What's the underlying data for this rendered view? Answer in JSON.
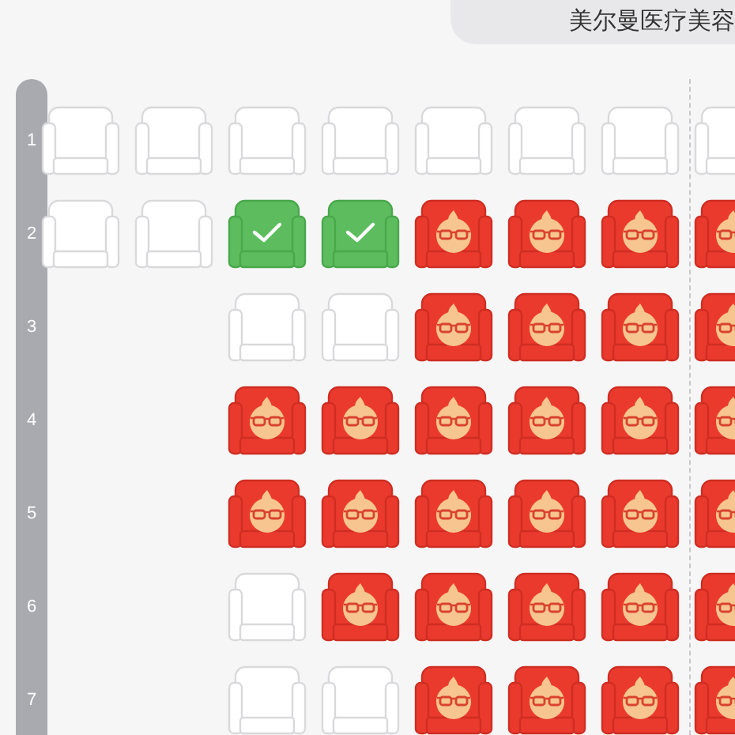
{
  "header": {
    "title": "美尔曼医疗美容"
  },
  "rows": [
    {
      "label": "1",
      "seats": [
        {
          "kind": "empty"
        },
        {
          "kind": "empty"
        },
        {
          "kind": "empty"
        },
        {
          "kind": "empty"
        },
        {
          "kind": "empty"
        },
        {
          "kind": "empty"
        },
        {
          "kind": "empty"
        },
        {
          "kind": "empty"
        }
      ]
    },
    {
      "label": "2",
      "seats": [
        {
          "kind": "empty"
        },
        {
          "kind": "empty"
        },
        {
          "kind": "selected"
        },
        {
          "kind": "selected"
        },
        {
          "kind": "sold"
        },
        {
          "kind": "sold"
        },
        {
          "kind": "sold"
        },
        {
          "kind": "sold"
        }
      ]
    },
    {
      "label": "3",
      "seats": [
        {
          "kind": "gap"
        },
        {
          "kind": "gap"
        },
        {
          "kind": "empty"
        },
        {
          "kind": "empty"
        },
        {
          "kind": "sold"
        },
        {
          "kind": "sold"
        },
        {
          "kind": "sold"
        },
        {
          "kind": "sold"
        }
      ]
    },
    {
      "label": "4",
      "seats": [
        {
          "kind": "gap"
        },
        {
          "kind": "gap"
        },
        {
          "kind": "sold"
        },
        {
          "kind": "sold"
        },
        {
          "kind": "sold"
        },
        {
          "kind": "sold"
        },
        {
          "kind": "sold"
        },
        {
          "kind": "sold"
        }
      ]
    },
    {
      "label": "5",
      "seats": [
        {
          "kind": "gap"
        },
        {
          "kind": "gap"
        },
        {
          "kind": "sold"
        },
        {
          "kind": "sold"
        },
        {
          "kind": "sold"
        },
        {
          "kind": "sold"
        },
        {
          "kind": "sold"
        },
        {
          "kind": "sold"
        }
      ]
    },
    {
      "label": "6",
      "seats": [
        {
          "kind": "gap"
        },
        {
          "kind": "gap"
        },
        {
          "kind": "empty"
        },
        {
          "kind": "sold"
        },
        {
          "kind": "sold"
        },
        {
          "kind": "sold"
        },
        {
          "kind": "sold"
        },
        {
          "kind": "sold"
        }
      ]
    },
    {
      "label": "7",
      "seats": [
        {
          "kind": "gap"
        },
        {
          "kind": "gap"
        },
        {
          "kind": "empty"
        },
        {
          "kind": "empty"
        },
        {
          "kind": "sold"
        },
        {
          "kind": "sold"
        },
        {
          "kind": "sold"
        },
        {
          "kind": "sold"
        }
      ]
    }
  ]
}
